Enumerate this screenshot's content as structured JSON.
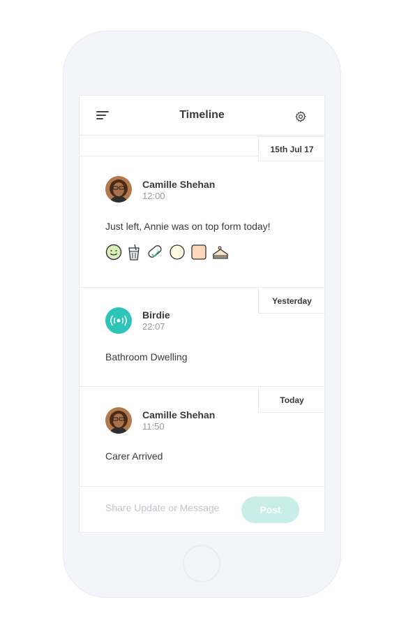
{
  "header": {
    "title": "Timeline",
    "menu_icon": "menu-icon",
    "settings_icon": "gear-icon"
  },
  "timeline": [
    {
      "date_label": "15th Jul 17",
      "author": "Camille Shehan",
      "time": "12:00",
      "message": "Just left, Annie was on top form today!",
      "avatar": "person-avatar",
      "mood_icons": [
        "smiley-icon",
        "drink-icon",
        "medication-icon",
        "circle-icon",
        "square-icon",
        "cake-icon"
      ]
    },
    {
      "date_label": "Yesterday",
      "author": "Birdie",
      "time": "22:07",
      "message": "Bathroom Dwelling",
      "avatar": "sensor-avatar"
    },
    {
      "date_label": "Today",
      "author": "Camille Shehan",
      "time": "11:50",
      "message": "Carer Arrived",
      "avatar": "person-avatar"
    }
  ],
  "composer": {
    "placeholder": "Share Update or Message",
    "post_label": "Post"
  },
  "colors": {
    "accent": "#2cc5b8",
    "post_button": "#c9eeea",
    "background": "#f3f5fb"
  }
}
